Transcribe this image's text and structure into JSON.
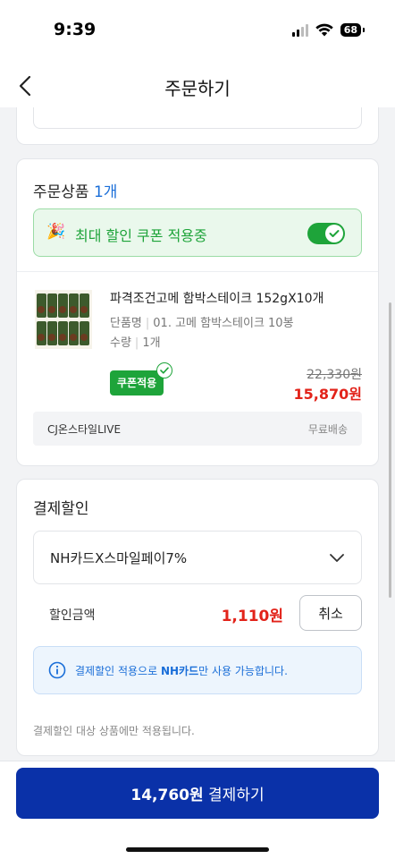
{
  "status_bar": {
    "time": "9:39",
    "battery": "68"
  },
  "nav": {
    "title": "주문하기",
    "back_icon": "chevron-left-icon"
  },
  "order_section": {
    "title": "주문상품",
    "count": "1개",
    "coupon_banner": {
      "icon": "party-popper-icon",
      "text": "최대 할인 쿠폰 적용중",
      "toggle_on": true
    },
    "product": {
      "name": "파격조건고메 함박스테이크 152gX10개",
      "option_label": "단품명",
      "option_value": "01. 고메 함박스테이크 10봉",
      "qty_label": "수량",
      "qty_value": "1개",
      "coupon_badge": "쿠폰적용",
      "original_price": "22,330원",
      "final_price": "15,870원"
    },
    "seller": {
      "name": "CJ온스타일LIVE",
      "shipping": "무료배송"
    }
  },
  "payment_discount": {
    "title": "결제할인",
    "selected_method": "NH카드X스마일페이7%",
    "discount_label": "할인금액",
    "discount_amount": "1,110원",
    "cancel_label": "취소",
    "info_prefix": "결제할인 적용으로 ",
    "info_bold": "NH카드",
    "info_suffix": "만 사용 가능합니다.",
    "footnote": "결제할인 대상 상품에만 적용됩니다."
  },
  "bottom": {
    "pay_amount": "14,760원",
    "pay_label": "결제하기"
  },
  "colors": {
    "accent_green": "#1ea43a",
    "price_red": "#e2231a",
    "link_blue": "#1a6ed8",
    "pay_button": "#0a31a8"
  }
}
